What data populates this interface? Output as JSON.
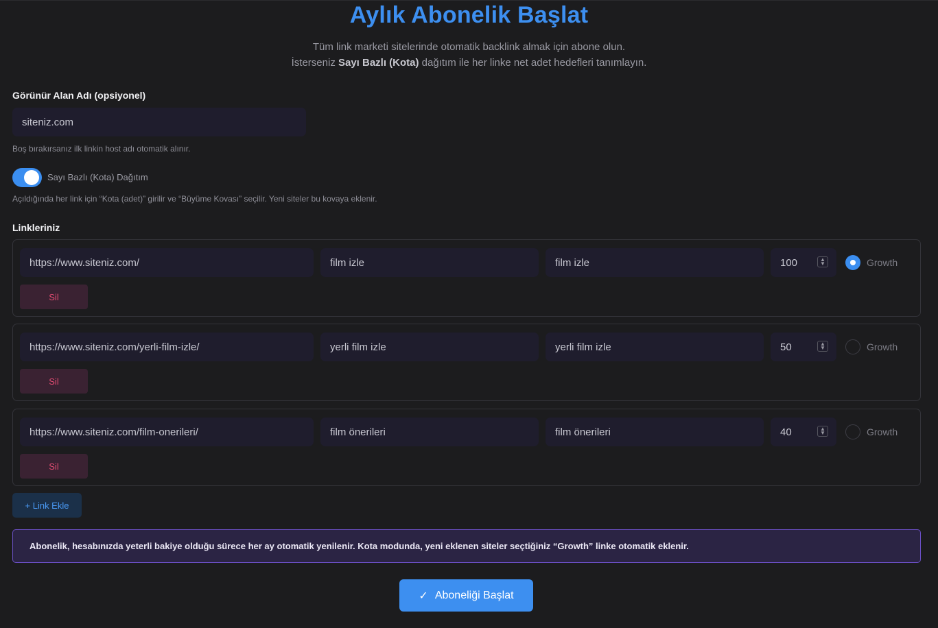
{
  "header": {
    "title": "Aylık Abonelik Başlat",
    "subtitle_line1": "Tüm link marketi sitelerinde otomatik backlink almak için abone olun.",
    "subtitle_line2_pre": "İsterseniz ",
    "subtitle_line2_bold": "Sayı Bazlı (Kota)",
    "subtitle_line2_post": " dağıtım ile her linke net adet hedefleri tanımlayın."
  },
  "domain_field": {
    "label": "Görünür Alan Adı (opsiyonel)",
    "value": "siteniz.com",
    "hint": "Boş bırakırsanız ilk linkin host adı otomatik alınır."
  },
  "quota_toggle": {
    "enabled": true,
    "label": "Sayı Bazlı (Kota) Dağıtım",
    "hint": "Açıldığında her link için “Kota (adet)” girilir ve “Büyüme Kovası” seçilir. Yeni siteler bu kovaya eklenir."
  },
  "links": {
    "label": "Linkleriniz",
    "rows": [
      {
        "url": "https://www.siteniz.com/",
        "anchor": "film izle",
        "keyword": "film izle",
        "quota": "100",
        "growth_selected": true,
        "growth_label": "Growth",
        "delete_label": "Sil"
      },
      {
        "url": "https://www.siteniz.com/yerli-film-izle/",
        "anchor": "yerli film izle",
        "keyword": "yerli film izle",
        "quota": "50",
        "growth_selected": false,
        "growth_label": "Growth",
        "delete_label": "Sil"
      },
      {
        "url": "https://www.siteniz.com/film-onerileri/",
        "anchor": "film önerileri",
        "keyword": "film önerileri",
        "quota": "40",
        "growth_selected": false,
        "growth_label": "Growth",
        "delete_label": "Sil"
      }
    ],
    "add_label": "+ Link Ekle"
  },
  "notice": {
    "text": "Abonelik, hesabınızda yeterli bakiye olduğu sürece her ay otomatik yenilenir. Kota modunda, yeni eklenen siteler seçtiğiniz “Growth” linke otomatik eklenir."
  },
  "submit": {
    "icon": "check-icon",
    "label": "Aboneliği Başlat"
  },
  "colors": {
    "accent": "#3d8ff0",
    "background": "#1c1c1e",
    "input_bg": "#1f1d2d",
    "danger": "#e04c72",
    "notice_border": "#6a4fc4"
  }
}
